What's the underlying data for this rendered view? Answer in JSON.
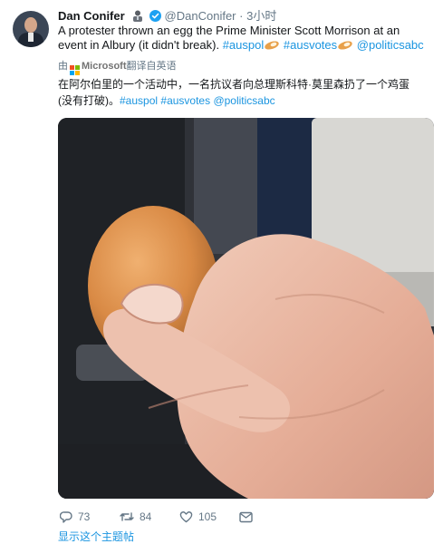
{
  "tweet": {
    "author_name": "Dan Conifer",
    "handle": "@DanConifer",
    "separator": "·",
    "time": "3小时",
    "text_main": "A protester thrown an egg the Prime Minister Scott Morrison at an event in Albury (it didn't break).",
    "hashtag_1": "#auspol",
    "hashtag_2": "#ausvotes",
    "mention": "@politicsabc",
    "icons": [
      "business-person-emoji",
      "verified-badge",
      "egg-emoji",
      "microsoft-logo"
    ]
  },
  "translation": {
    "prefix": "由",
    "brand": "Microsoft",
    "suffix": "翻译自英语",
    "text_main": "在阿尔伯里的一个活动中，一名抗议者向总理斯科特·莫里森扔了一个鸡蛋 (没有打破)。",
    "hashtag_1": "#auspol",
    "hashtag_2": "#ausvotes",
    "mention": "@politicsabc"
  },
  "media": {
    "description_icon": "photo-egg-in-hand"
  },
  "actions": {
    "reply_count": "73",
    "retweet_count": "84",
    "like_count": "105"
  },
  "thread_link": "显示这个主题帖",
  "colors": {
    "link": "#1b95e0",
    "secondary": "#657786",
    "verified": "#1da1f2",
    "ms_red": "#f25022",
    "ms_green": "#7fba00",
    "ms_blue": "#00a4ef",
    "ms_yellow": "#ffb900"
  }
}
